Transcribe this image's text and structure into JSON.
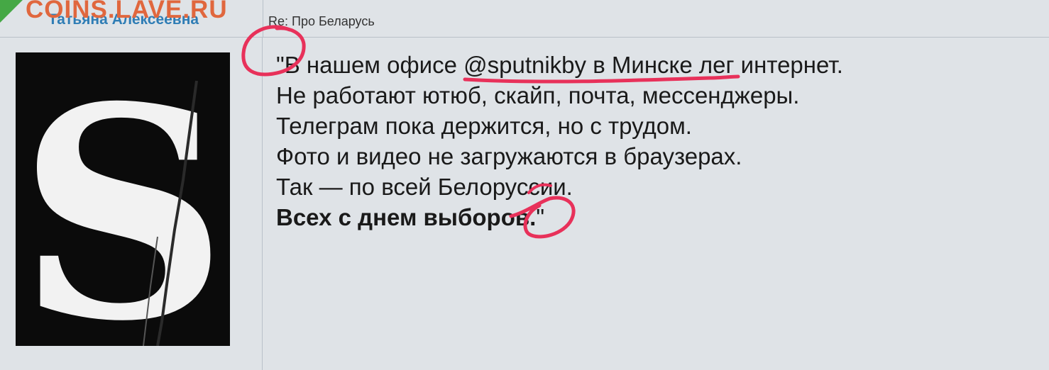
{
  "watermark": "COINS.LAVE.RU",
  "post": {
    "author": "Татьяна Алексеевна",
    "subject": "Re: Про Беларусь",
    "avatar_icon": "letter-s-avatar",
    "lines": [
      "\"В нашем офисе @sputnikby в Минске лег интернет.",
      "Не работают ютюб, скайп, почта, мессенджеры.",
      "Телеграм пока держится, но с трудом.",
      "Фото и видео не загружаются в браузерах.",
      "Так — по всей Белоруссии."
    ],
    "bold_line": "Всех с днем выборов.",
    "closing_quote": "\""
  },
  "colors": {
    "annotation": "#e8315a",
    "author": "#2f7db5",
    "watermark": "#e0673e",
    "flag": "#45a845"
  }
}
